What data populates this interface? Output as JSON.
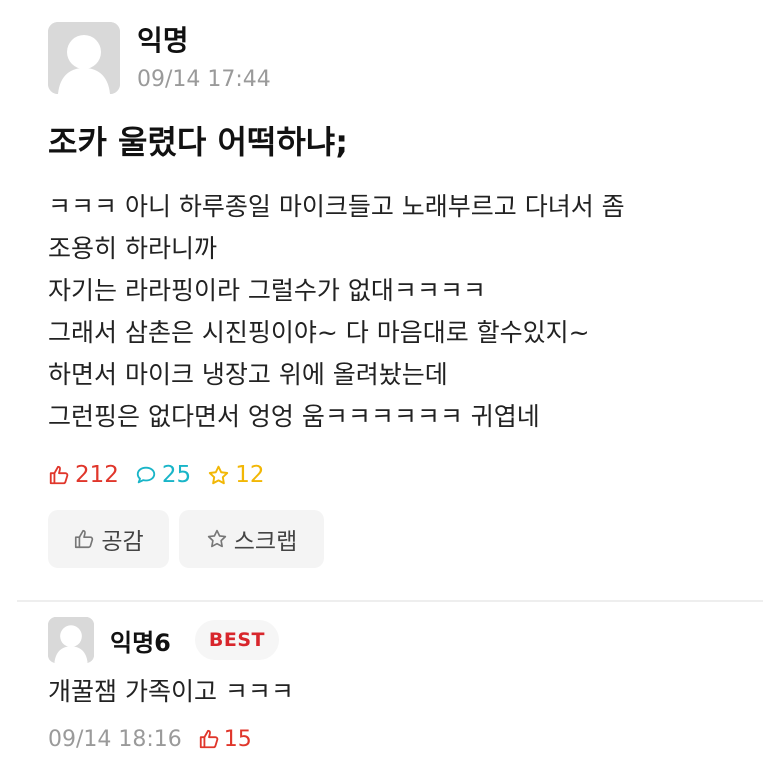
{
  "post": {
    "author": "익명",
    "time": "09/14 17:44",
    "title": "조카 울렸다 어떡하냐;",
    "body_lines": [
      "ㅋㅋㅋ 아니 하루종일 마이크들고 노래부르고 다녀서 좀",
      "조용히 하라니까",
      "자기는 라라핑이라 그럴수가 없대ㅋㅋㅋㅋ",
      "그래서 삼촌은 시진핑이야~ 다 마음대로 할수있지~",
      "하면서 마이크 냉장고 위에 올려놨는데",
      "그런핑은 없다면서 엉엉 움ㅋㅋㅋㅋㅋㅋ 귀엽네"
    ],
    "stats": {
      "likes": "212",
      "comments": "25",
      "scraps": "12"
    },
    "actions": {
      "like_label": "공감",
      "scrap_label": "스크랩"
    }
  },
  "comment": {
    "author": "익명6",
    "badge": "BEST",
    "text": "개꿀잼 가족이고 ㅋㅋㅋ",
    "time": "09/14 18:16",
    "likes": "15"
  },
  "icons": {
    "avatar": "default-avatar-icon",
    "like": "thumbs-up-icon",
    "comment": "speech-bubble-icon",
    "scrap": "star-icon"
  },
  "colors": {
    "like": "#e0362b",
    "comment": "#19b5c8",
    "scrap": "#f2b705",
    "best": "#d8262c",
    "muted": "#9a9a9a"
  }
}
